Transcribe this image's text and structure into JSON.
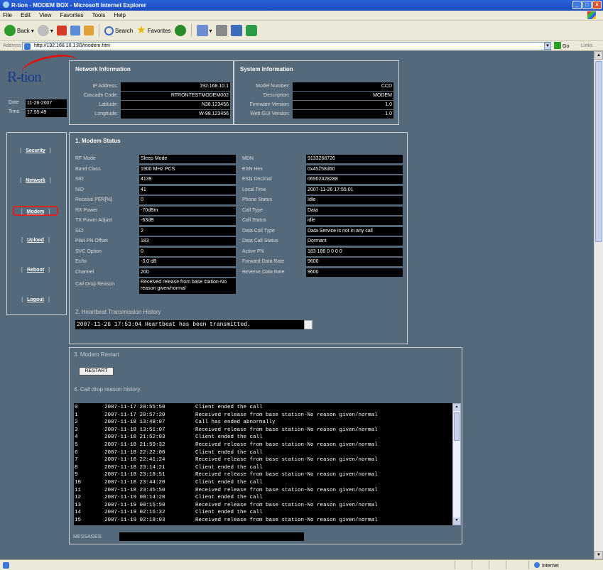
{
  "window": {
    "title": "R-tion - MODEM BOX - Microsoft Internet Explorer"
  },
  "menu": [
    "File",
    "Edit",
    "View",
    "Favorites",
    "Tools",
    "Help"
  ],
  "toolbar": {
    "back": "Back",
    "search": "Search",
    "favorites": "Favorites"
  },
  "address": {
    "label": "Address",
    "url": "http://192.168.10.1:83/modem.htm",
    "go": "Go",
    "links": "Links"
  },
  "status": {
    "zone": "Internet"
  },
  "logo": "R-tion",
  "datetime": {
    "date_label": "Date",
    "date": "11-26-2007",
    "time_label": "Time",
    "time": "17:55:49"
  },
  "network": {
    "title": "Network Information",
    "fields": [
      {
        "label": "IP Address:",
        "value": "192.168.10.1"
      },
      {
        "label": "Cascade Code:",
        "value": "RTRONTESTMODEM002"
      },
      {
        "label": "Latitude:",
        "value": "N38.123456"
      },
      {
        "label": "Longitude:",
        "value": "W-98.123456"
      }
    ]
  },
  "system": {
    "title": "System Information",
    "fields": [
      {
        "label": "Model Number:",
        "value": "CCD"
      },
      {
        "label": "Description:",
        "value": "MODEM"
      },
      {
        "label": "Firmware Version:",
        "value": "1.0"
      },
      {
        "label": "Web GUI Version:",
        "value": "1.0"
      }
    ]
  },
  "nav": [
    {
      "label": "Security",
      "active": false
    },
    {
      "label": "Network",
      "active": false
    },
    {
      "label": "Modem",
      "active": true
    },
    {
      "label": "Upload",
      "active": false
    },
    {
      "label": "Reboot",
      "active": false
    },
    {
      "label": "Logout",
      "active": false
    }
  ],
  "modem_status": {
    "title": "1. Modem Status",
    "left": [
      {
        "label": "RF Mode",
        "value": "Sleep Mode"
      },
      {
        "label": "Band Class",
        "value": "1900 MHz PCS"
      },
      {
        "label": "SID",
        "value": "4139"
      },
      {
        "label": "NID",
        "value": "41"
      },
      {
        "label": "Receive PER[%]",
        "value": "0"
      },
      {
        "label": "RX Power",
        "value": "-70dBm"
      },
      {
        "label": "TX Power Adjust",
        "value": "-63dB"
      },
      {
        "label": "SCI",
        "value": "2"
      },
      {
        "label": "Pilot PN Offset",
        "value": "183"
      },
      {
        "label": "SVC Option",
        "value": "0"
      },
      {
        "label": "Ec/Io",
        "value": "-3.0 dB"
      },
      {
        "label": "Channel",
        "value": "200"
      },
      {
        "label": "Call Drop Reason",
        "value": "Received release from base station-No reason given/normal"
      }
    ],
    "right": [
      {
        "label": "MDN",
        "value": "9133268726"
      },
      {
        "label": "ESN Hex",
        "value": "0x45258d60"
      },
      {
        "label": "ESN Decimal",
        "value": "06902428288"
      },
      {
        "label": "Local Time",
        "value": "2007-11-26 17:55:01"
      },
      {
        "label": "Phone Status",
        "value": "Idle"
      },
      {
        "label": "Call Type",
        "value": "Data"
      },
      {
        "label": "Call Status",
        "value": "idle"
      },
      {
        "label": "Data Call Type",
        "value": "Data Service is not in any call"
      },
      {
        "label": "Data Call Status",
        "value": "Dormant"
      },
      {
        "label": "Active PN",
        "value": "183 186 0 0 0 0"
      },
      {
        "label": "Forward Data Rate",
        "value": "9600"
      },
      {
        "label": "Reverse Data Rate",
        "value": "9600"
      }
    ]
  },
  "heartbeat": {
    "title": "2. Heartbeat Transmission History",
    "text": "2007-11-26 17:53:04 Heartbeat has been transmitted."
  },
  "restart": {
    "title": "3. Modem Restart",
    "button": "RESTART"
  },
  "call_drop": {
    "title": "4. Call drop reason history",
    "rows": [
      {
        "n": "0",
        "t": "2007-11-17 20:55:50",
        "r": "Client ended the call"
      },
      {
        "n": "1",
        "t": "2007-11-17 20:57:20",
        "r": "Received release from base station-No reason given/normal"
      },
      {
        "n": "2",
        "t": "2007-11-18 13:48:07",
        "r": "Call has ended abnormally"
      },
      {
        "n": "3",
        "t": "2007-11-18 13:51:07",
        "r": "Received release from base station-No reason given/normal"
      },
      {
        "n": "4",
        "t": "2007-11-18 21:52:03",
        "r": "Client ended the call"
      },
      {
        "n": "5",
        "t": "2007-11-18 21:59:32",
        "r": "Received release from base station-No reason given/normal"
      },
      {
        "n": "6",
        "t": "2007-11-18 22:22:00",
        "r": "Client ended the call"
      },
      {
        "n": "7",
        "t": "2007-11-18 22:41:24",
        "r": "Received release from base station-No reason given/normal"
      },
      {
        "n": "8",
        "t": "2007-11-18 23:14:21",
        "r": "Client ended the call"
      },
      {
        "n": "9",
        "t": "2007-11-18 23:18:51",
        "r": "Received release from base station-No reason given/normal"
      },
      {
        "n": "10",
        "t": "2007-11-18 23:44:20",
        "r": "Client ended the call"
      },
      {
        "n": "11",
        "t": "2007-11-18 23:45:50",
        "r": "Received release from base station-No reason given/normal"
      },
      {
        "n": "12",
        "t": "2007-11-19 00:14:20",
        "r": "Client ended the call"
      },
      {
        "n": "13",
        "t": "2007-11-19 00:15:50",
        "r": "Received release from base station-No reason given/normal"
      },
      {
        "n": "14",
        "t": "2007-11-19 02:16:32",
        "r": "Client ended the call"
      },
      {
        "n": "15",
        "t": "2007-11-19 02:18:03",
        "r": "Received release from base station-No reason given/normal"
      }
    ]
  },
  "messages": {
    "label": "MESSAGES:",
    "value": ""
  }
}
